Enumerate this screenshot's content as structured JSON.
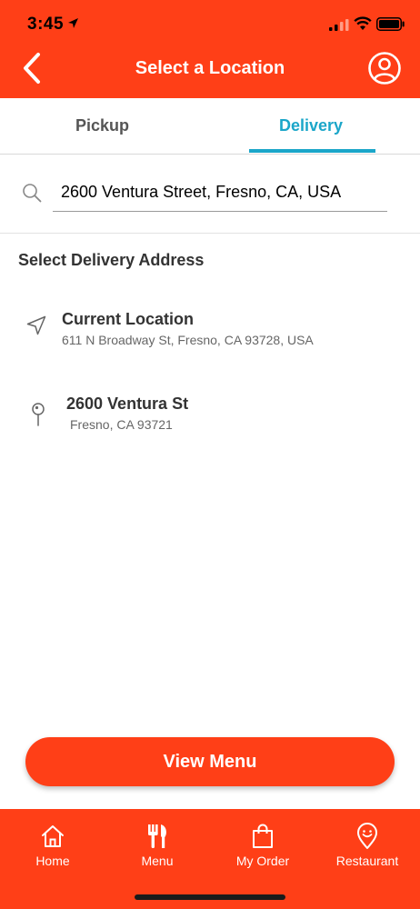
{
  "status_bar": {
    "time": "3:45"
  },
  "header": {
    "title": "Select a Location"
  },
  "tabs": [
    {
      "label": "Pickup",
      "active": false
    },
    {
      "label": "Delivery",
      "active": true
    }
  ],
  "search": {
    "value": "2600 Ventura Street, Fresno, CA, USA"
  },
  "section": {
    "title": "Select Delivery Address"
  },
  "addresses": [
    {
      "name": "Current Location",
      "detail": "611 N Broadway St, Fresno, CA 93728, USA",
      "icon": "navigation-arrow-icon"
    },
    {
      "name": "2600 Ventura St",
      "detail": "Fresno, CA 93721",
      "icon": "map-pin-icon"
    }
  ],
  "cta": {
    "label": "View Menu"
  },
  "bottom_nav": [
    {
      "label": "Home",
      "icon": "home-icon"
    },
    {
      "label": "Menu",
      "icon": "fork-knife-icon"
    },
    {
      "label": "My Order",
      "icon": "shopping-bag-icon"
    },
    {
      "label": "Restaurant",
      "icon": "restaurant-pin-icon"
    }
  ],
  "colors": {
    "brand": "#FF3F17",
    "accent": "#1BA6C9"
  }
}
